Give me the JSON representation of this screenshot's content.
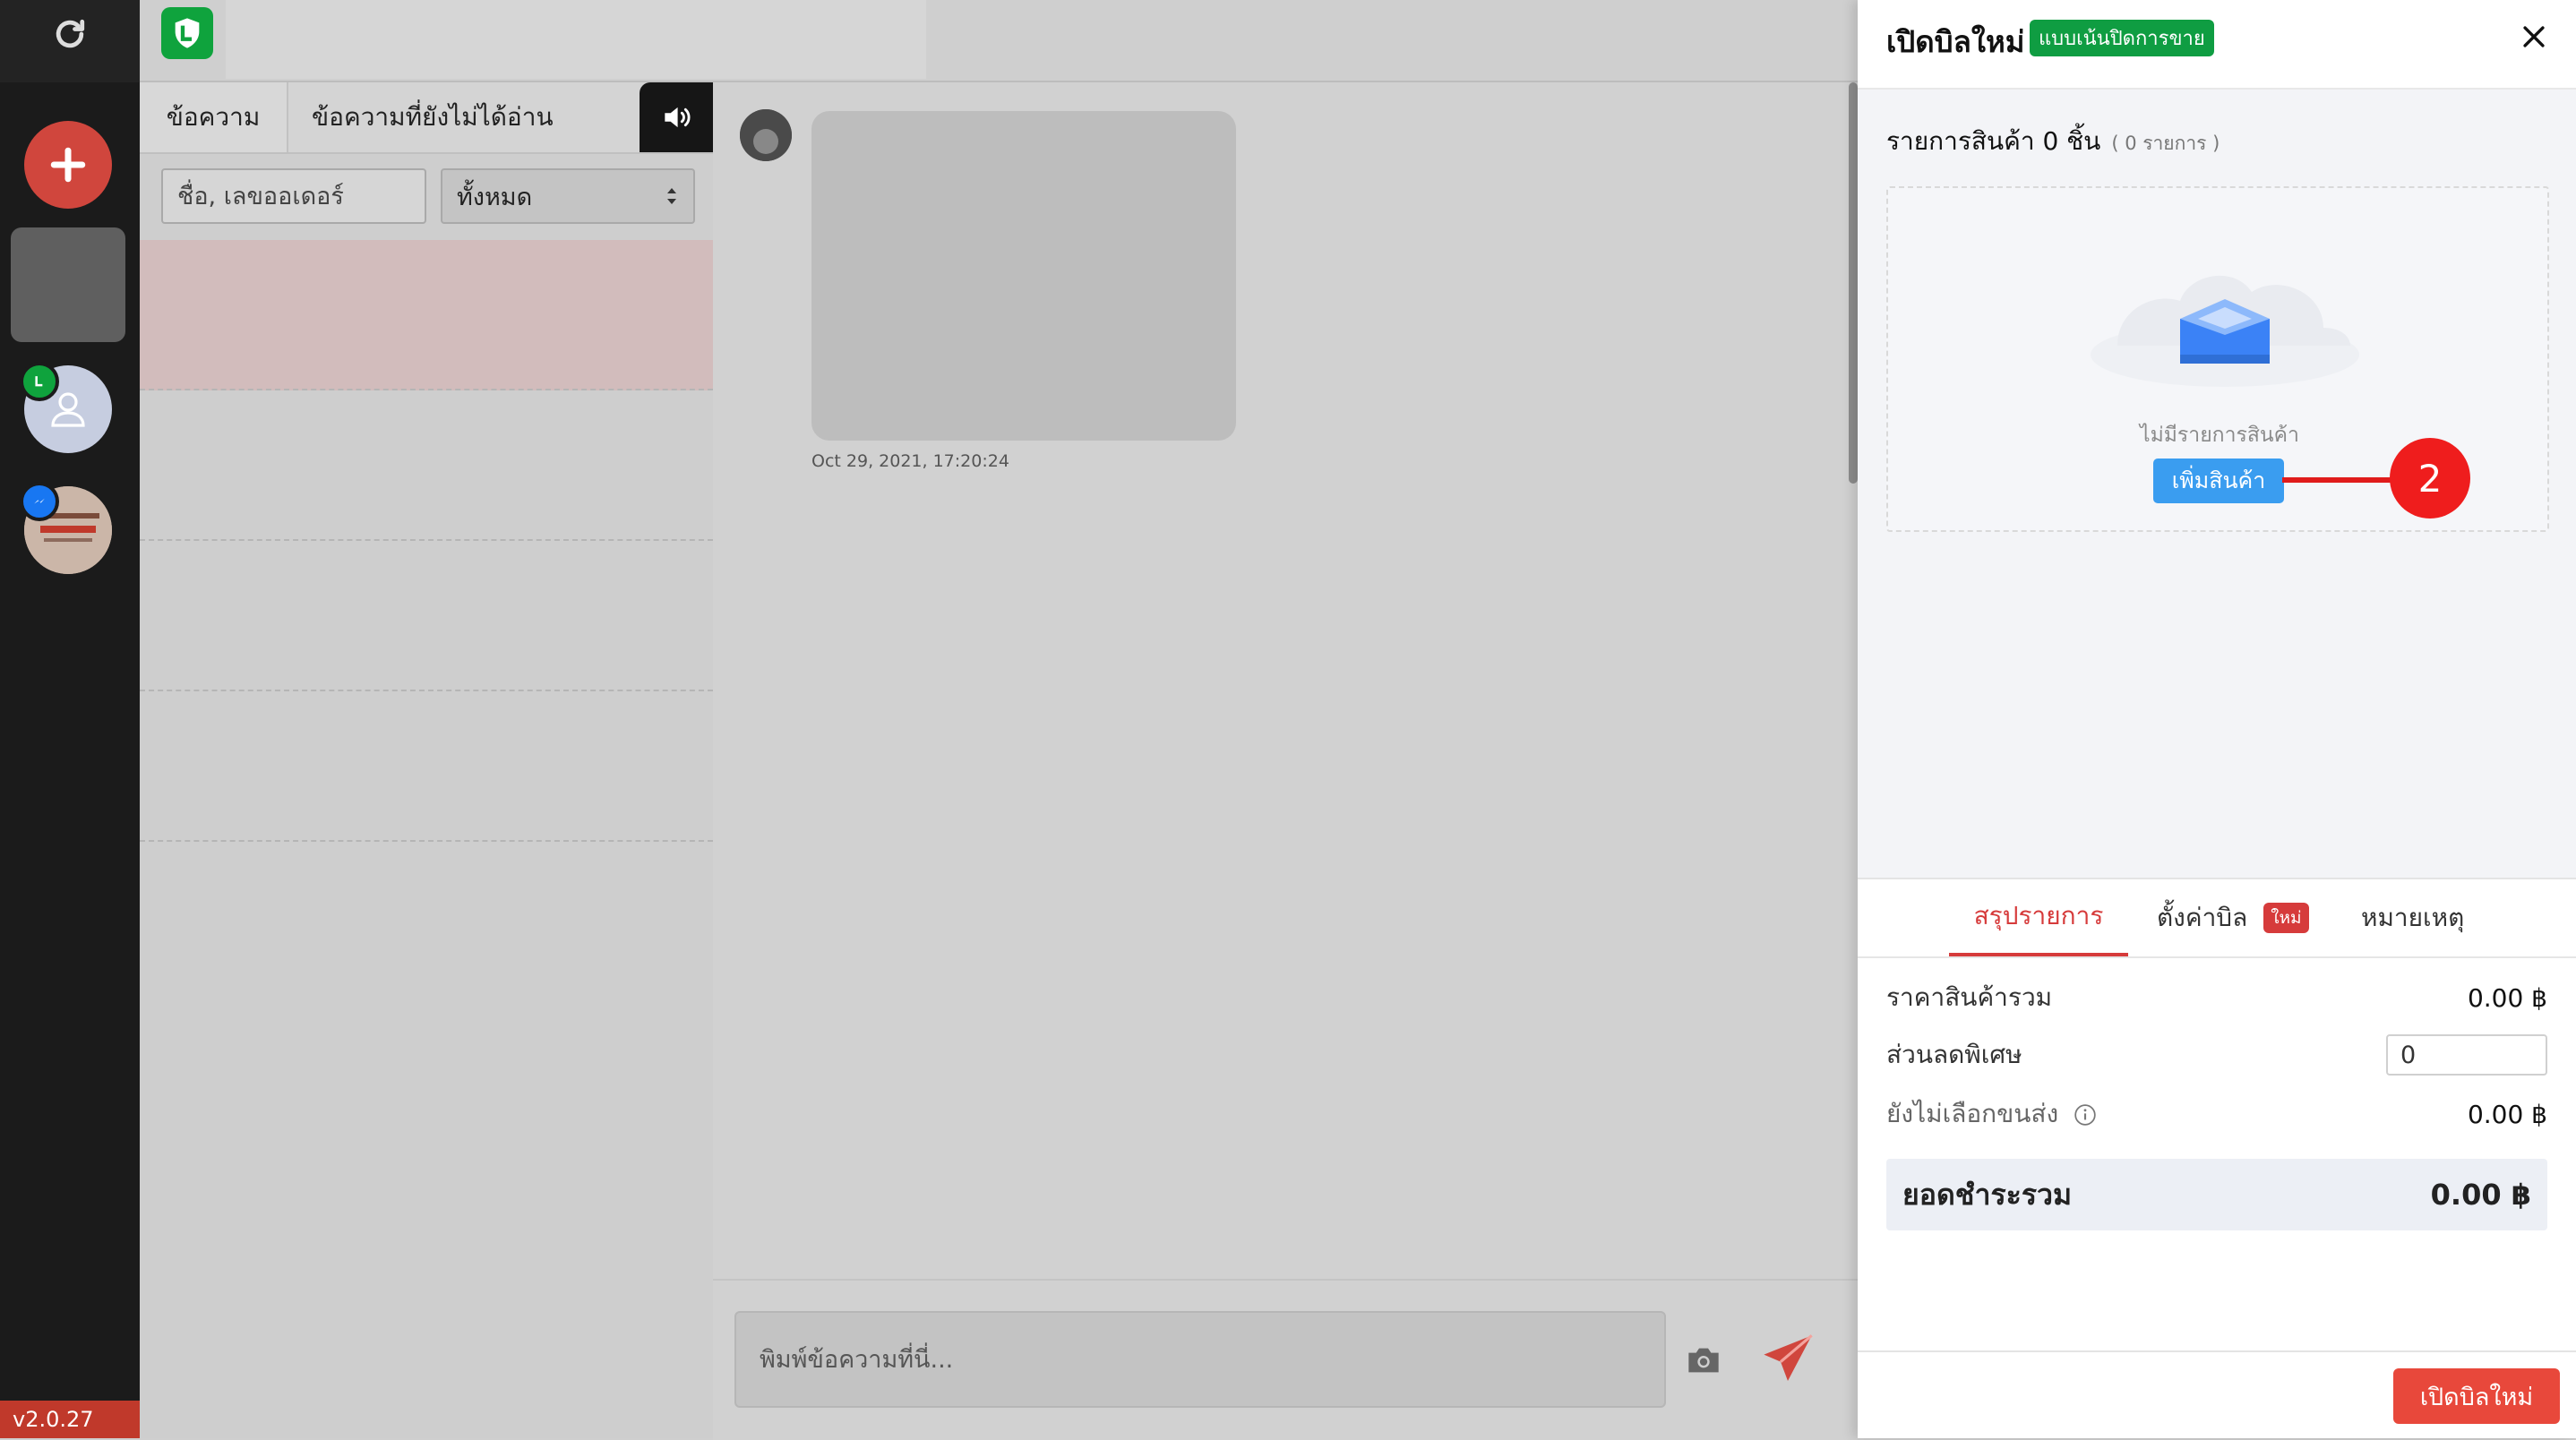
{
  "rail": {
    "version": "v2.0.27",
    "icons": [
      "refresh-icon",
      "plus-icon",
      "user-icon",
      "line-badge-icon",
      "messenger-badge-icon"
    ]
  },
  "chat_list": {
    "tabs": [
      "ข้อความ",
      "ข้อความที่ยังไม่ได้อ่าน"
    ],
    "search_placeholder": "ชื่อ, เลขออเดอร์",
    "filter_value": "ทั้งหมด"
  },
  "chat": {
    "timestamp": "Oct 29, 2021, 17:20:24",
    "input_placeholder": "พิมพ์ข้อความที่นี่..."
  },
  "bill": {
    "title": "เปิดบิลใหม่",
    "mode_badge": "แบบเน้นปิดการขาย",
    "items_heading": "รายการสินค้า 0 ชิ้น",
    "items_count": "( 0 รายการ )",
    "empty_text": "ไม่มีรายการสินค้า",
    "add_button": "เพิ่มสินค้า",
    "callout_number": "2",
    "tabs": {
      "summary": "สรุปรายการ",
      "settings": "ตั้งค่าบิล",
      "settings_badge": "ใหม่",
      "notes": "หมายเหตุ"
    },
    "rows": {
      "subtotal_label": "ราคาสินค้ารวม",
      "subtotal_value": "0.00 ฿",
      "discount_label": "ส่วนลดพิเศษ",
      "discount_value": "0",
      "shipping_label": "ยังไม่เลือกขนส่ง",
      "shipping_value": "0.00 ฿",
      "total_label": "ยอดชำระรวม",
      "total_value": "0.00 ฿"
    },
    "submit_button": "เปิดบิลใหม่"
  },
  "colors": {
    "rail_bg": "#1b1b1b",
    "accent_red": "#e8483b",
    "mode_green": "#0f9d42",
    "add_blue": "#3a9df0"
  }
}
